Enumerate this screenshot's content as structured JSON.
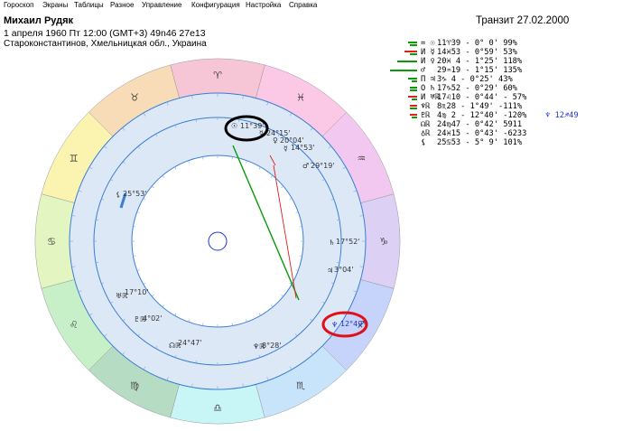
{
  "menu": [
    "Гороскоп",
    "Экраны",
    "Таблицы",
    "Разное",
    "Управление",
    "Конфигурация",
    "Настройка",
    "Справка"
  ],
  "header": {
    "name": "Михаил Рудяк",
    "birth": "1 апреля 1960  Пт  12:00 (GMT+3) 49n46  27e13",
    "place": "Староконстантинов, Хмельницкая обл., Украина",
    "transit": "Транзит 27.02.2000"
  },
  "colors": {
    "green": "#0a9a0a",
    "red": "#e02020",
    "blue": "#2233cc",
    "ring": "#3a7fd5",
    "inner_fill": "#dde8f7",
    "highlight_black": "#000000",
    "highlight_red": "#e0101a"
  },
  "planets": [
    {
      "glyph": "= ☉",
      "pos": "11♈39 -  0° 0'   99%"
    },
    {
      "glyph": "И ☿",
      "pos": "14♓53 -  0°59'   53%"
    },
    {
      "glyph": "И ♀",
      "pos": "20♓ 4  -  1°25'  118%"
    },
    {
      "glyph": "♂",
      "pos": "29♒19 -  1°15'  135%"
    },
    {
      "glyph": "П ♃",
      "pos": " 3♑ 4  -  0°25'   43%"
    },
    {
      "glyph": "О ♄",
      "pos": "17♑52 -  0°29'   60%"
    },
    {
      "glyph": "И ♅ℝ",
      "pos": "17♌10 -  0°44' - 57%"
    },
    {
      "glyph": "♆ℝ",
      "pos": " 8♏28 -  1°49' -111%"
    },
    {
      "glyph": "♇ℝ",
      "pos": " 4♍ 2  - 12°40' -120%",
      "extra": "♆  12♐49"
    },
    {
      "glyph": "☊ℝ",
      "pos": "24♍47 -  0°42'  5911"
    },
    {
      "glyph": "♁ℝ",
      "pos": "24♓15 -  0°43' -6233"
    },
    {
      "glyph": "⚸",
      "pos": "25♋53 -  5° 9'  101%"
    }
  ],
  "zodiac": [
    {
      "glyph": "♈",
      "color": "#f7c6d6"
    },
    {
      "glyph": "♉",
      "color": "#f8dcb8"
    },
    {
      "glyph": "♊",
      "color": "#fbf4b0"
    },
    {
      "glyph": "♋",
      "color": "#e3f6c2"
    },
    {
      "glyph": "♌",
      "color": "#c8f0c8"
    },
    {
      "glyph": "♍",
      "color": "#b6dcc4"
    },
    {
      "glyph": "♎",
      "color": "#c8f6f6"
    },
    {
      "glyph": "♏",
      "color": "#c8e4fb"
    },
    {
      "glyph": "♐",
      "color": "#c6d4fb"
    },
    {
      "glyph": "♑",
      "color": "#ddd0f5"
    },
    {
      "glyph": "♒",
      "color": "#f3c8f0"
    },
    {
      "glyph": "♓",
      "color": "#fbc8e6"
    }
  ],
  "wheel_planets": [
    {
      "glyph": "☉",
      "label": "11°39'"
    },
    {
      "glyph": "☿",
      "label": "24°15'"
    },
    {
      "glyph": "♀",
      "label": "20°04'"
    },
    {
      "glyph": "☿",
      "label": "14°53'"
    },
    {
      "glyph": "♂",
      "label": "29°19'"
    },
    {
      "glyph": "♄",
      "label": "17°52'"
    },
    {
      "glyph": "♃",
      "label": "3°04'"
    },
    {
      "glyph": "⚸",
      "label": "25°53'"
    },
    {
      "glyph": "♅ℝ",
      "label": "17°10'"
    },
    {
      "glyph": "♇ℝ",
      "label": "4°02'"
    },
    {
      "glyph": "☊ℝ",
      "label": "24°47'"
    },
    {
      "glyph": "♆ℝ",
      "label": "8°28'"
    },
    {
      "glyph": "♆",
      "label": "12°49'"
    }
  ]
}
